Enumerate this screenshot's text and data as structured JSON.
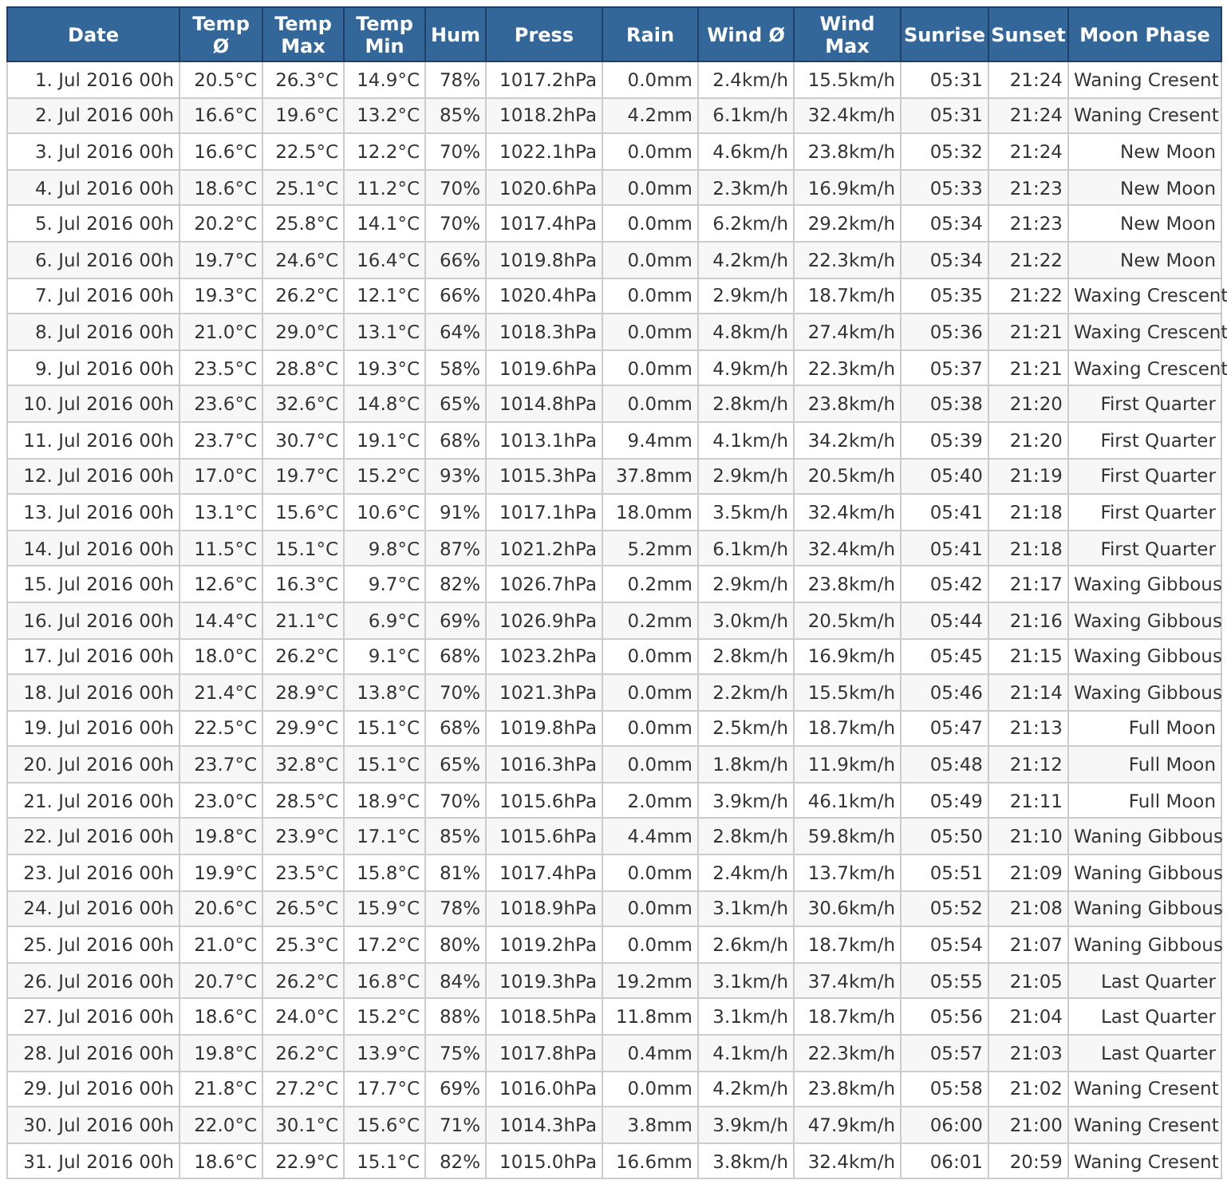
{
  "table": {
    "columns": [
      "Date",
      "Temp Ø",
      "Temp Max",
      "Temp Min",
      "Hum",
      "Press",
      "Rain",
      "Wind Ø",
      "Wind Max",
      "Sunrise",
      "Sunset",
      "Moon Phase"
    ],
    "rows": [
      [
        "1. Jul 2016 00h",
        "20.5°C",
        "26.3°C",
        "14.9°C",
        "78%",
        "1017.2hPa",
        "0.0mm",
        "2.4km/h",
        "15.5km/h",
        "05:31",
        "21:24",
        "Waning Cresent"
      ],
      [
        "2. Jul 2016 00h",
        "16.6°C",
        "19.6°C",
        "13.2°C",
        "85%",
        "1018.2hPa",
        "4.2mm",
        "6.1km/h",
        "32.4km/h",
        "05:31",
        "21:24",
        "Waning Cresent"
      ],
      [
        "3. Jul 2016 00h",
        "16.6°C",
        "22.5°C",
        "12.2°C",
        "70%",
        "1022.1hPa",
        "0.0mm",
        "4.6km/h",
        "23.8km/h",
        "05:32",
        "21:24",
        "New Moon"
      ],
      [
        "4. Jul 2016 00h",
        "18.6°C",
        "25.1°C",
        "11.2°C",
        "70%",
        "1020.6hPa",
        "0.0mm",
        "2.3km/h",
        "16.9km/h",
        "05:33",
        "21:23",
        "New Moon"
      ],
      [
        "5. Jul 2016 00h",
        "20.2°C",
        "25.8°C",
        "14.1°C",
        "70%",
        "1017.4hPa",
        "0.0mm",
        "6.2km/h",
        "29.2km/h",
        "05:34",
        "21:23",
        "New Moon"
      ],
      [
        "6. Jul 2016 00h",
        "19.7°C",
        "24.6°C",
        "16.4°C",
        "66%",
        "1019.8hPa",
        "0.0mm",
        "4.2km/h",
        "22.3km/h",
        "05:34",
        "21:22",
        "New Moon"
      ],
      [
        "7. Jul 2016 00h",
        "19.3°C",
        "26.2°C",
        "12.1°C",
        "66%",
        "1020.4hPa",
        "0.0mm",
        "2.9km/h",
        "18.7km/h",
        "05:35",
        "21:22",
        "Waxing Crescent"
      ],
      [
        "8. Jul 2016 00h",
        "21.0°C",
        "29.0°C",
        "13.1°C",
        "64%",
        "1018.3hPa",
        "0.0mm",
        "4.8km/h",
        "27.4km/h",
        "05:36",
        "21:21",
        "Waxing Crescent"
      ],
      [
        "9. Jul 2016 00h",
        "23.5°C",
        "28.8°C",
        "19.3°C",
        "58%",
        "1019.6hPa",
        "0.0mm",
        "4.9km/h",
        "22.3km/h",
        "05:37",
        "21:21",
        "Waxing Crescent"
      ],
      [
        "10. Jul 2016 00h",
        "23.6°C",
        "32.6°C",
        "14.8°C",
        "65%",
        "1014.8hPa",
        "0.0mm",
        "2.8km/h",
        "23.8km/h",
        "05:38",
        "21:20",
        "First Quarter"
      ],
      [
        "11. Jul 2016 00h",
        "23.7°C",
        "30.7°C",
        "19.1°C",
        "68%",
        "1013.1hPa",
        "9.4mm",
        "4.1km/h",
        "34.2km/h",
        "05:39",
        "21:20",
        "First Quarter"
      ],
      [
        "12. Jul 2016 00h",
        "17.0°C",
        "19.7°C",
        "15.2°C",
        "93%",
        "1015.3hPa",
        "37.8mm",
        "2.9km/h",
        "20.5km/h",
        "05:40",
        "21:19",
        "First Quarter"
      ],
      [
        "13. Jul 2016 00h",
        "13.1°C",
        "15.6°C",
        "10.6°C",
        "91%",
        "1017.1hPa",
        "18.0mm",
        "3.5km/h",
        "32.4km/h",
        "05:41",
        "21:18",
        "First Quarter"
      ],
      [
        "14. Jul 2016 00h",
        "11.5°C",
        "15.1°C",
        "9.8°C",
        "87%",
        "1021.2hPa",
        "5.2mm",
        "6.1km/h",
        "32.4km/h",
        "05:41",
        "21:18",
        "First Quarter"
      ],
      [
        "15. Jul 2016 00h",
        "12.6°C",
        "16.3°C",
        "9.7°C",
        "82%",
        "1026.7hPa",
        "0.2mm",
        "2.9km/h",
        "23.8km/h",
        "05:42",
        "21:17",
        "Waxing Gibbous"
      ],
      [
        "16. Jul 2016 00h",
        "14.4°C",
        "21.1°C",
        "6.9°C",
        "69%",
        "1026.9hPa",
        "0.2mm",
        "3.0km/h",
        "20.5km/h",
        "05:44",
        "21:16",
        "Waxing Gibbous"
      ],
      [
        "17. Jul 2016 00h",
        "18.0°C",
        "26.2°C",
        "9.1°C",
        "68%",
        "1023.2hPa",
        "0.0mm",
        "2.8km/h",
        "16.9km/h",
        "05:45",
        "21:15",
        "Waxing Gibbous"
      ],
      [
        "18. Jul 2016 00h",
        "21.4°C",
        "28.9°C",
        "13.8°C",
        "70%",
        "1021.3hPa",
        "0.0mm",
        "2.2km/h",
        "15.5km/h",
        "05:46",
        "21:14",
        "Waxing Gibbous"
      ],
      [
        "19. Jul 2016 00h",
        "22.5°C",
        "29.9°C",
        "15.1°C",
        "68%",
        "1019.8hPa",
        "0.0mm",
        "2.5km/h",
        "18.7km/h",
        "05:47",
        "21:13",
        "Full Moon"
      ],
      [
        "20. Jul 2016 00h",
        "23.7°C",
        "32.8°C",
        "15.1°C",
        "65%",
        "1016.3hPa",
        "0.0mm",
        "1.8km/h",
        "11.9km/h",
        "05:48",
        "21:12",
        "Full Moon"
      ],
      [
        "21. Jul 2016 00h",
        "23.0°C",
        "28.5°C",
        "18.9°C",
        "70%",
        "1015.6hPa",
        "2.0mm",
        "3.9km/h",
        "46.1km/h",
        "05:49",
        "21:11",
        "Full Moon"
      ],
      [
        "22. Jul 2016 00h",
        "19.8°C",
        "23.9°C",
        "17.1°C",
        "85%",
        "1015.6hPa",
        "4.4mm",
        "2.8km/h",
        "59.8km/h",
        "05:50",
        "21:10",
        "Waning Gibbous"
      ],
      [
        "23. Jul 2016 00h",
        "19.9°C",
        "23.5°C",
        "15.8°C",
        "81%",
        "1017.4hPa",
        "0.0mm",
        "2.4km/h",
        "13.7km/h",
        "05:51",
        "21:09",
        "Waning Gibbous"
      ],
      [
        "24. Jul 2016 00h",
        "20.6°C",
        "26.5°C",
        "15.9°C",
        "78%",
        "1018.9hPa",
        "0.0mm",
        "3.1km/h",
        "30.6km/h",
        "05:52",
        "21:08",
        "Waning Gibbous"
      ],
      [
        "25. Jul 2016 00h",
        "21.0°C",
        "25.3°C",
        "17.2°C",
        "80%",
        "1019.2hPa",
        "0.0mm",
        "2.6km/h",
        "18.7km/h",
        "05:54",
        "21:07",
        "Waning Gibbous"
      ],
      [
        "26. Jul 2016 00h",
        "20.7°C",
        "26.2°C",
        "16.8°C",
        "84%",
        "1019.3hPa",
        "19.2mm",
        "3.1km/h",
        "37.4km/h",
        "05:55",
        "21:05",
        "Last Quarter"
      ],
      [
        "27. Jul 2016 00h",
        "18.6°C",
        "24.0°C",
        "15.2°C",
        "88%",
        "1018.5hPa",
        "11.8mm",
        "3.1km/h",
        "18.7km/h",
        "05:56",
        "21:04",
        "Last Quarter"
      ],
      [
        "28. Jul 2016 00h",
        "19.8°C",
        "26.2°C",
        "13.9°C",
        "75%",
        "1017.8hPa",
        "0.4mm",
        "4.1km/h",
        "22.3km/h",
        "05:57",
        "21:03",
        "Last Quarter"
      ],
      [
        "29. Jul 2016 00h",
        "21.8°C",
        "27.2°C",
        "17.7°C",
        "69%",
        "1016.0hPa",
        "0.0mm",
        "4.2km/h",
        "23.8km/h",
        "05:58",
        "21:02",
        "Waning Cresent"
      ],
      [
        "30. Jul 2016 00h",
        "22.0°C",
        "30.1°C",
        "15.6°C",
        "71%",
        "1014.3hPa",
        "3.8mm",
        "3.9km/h",
        "47.9km/h",
        "06:00",
        "21:00",
        "Waning Cresent"
      ],
      [
        "31. Jul 2016 00h",
        "18.6°C",
        "22.9°C",
        "15.1°C",
        "82%",
        "1015.0hPa",
        "16.6mm",
        "3.8km/h",
        "32.4km/h",
        "06:01",
        "20:59",
        "Waning Cresent"
      ]
    ]
  }
}
